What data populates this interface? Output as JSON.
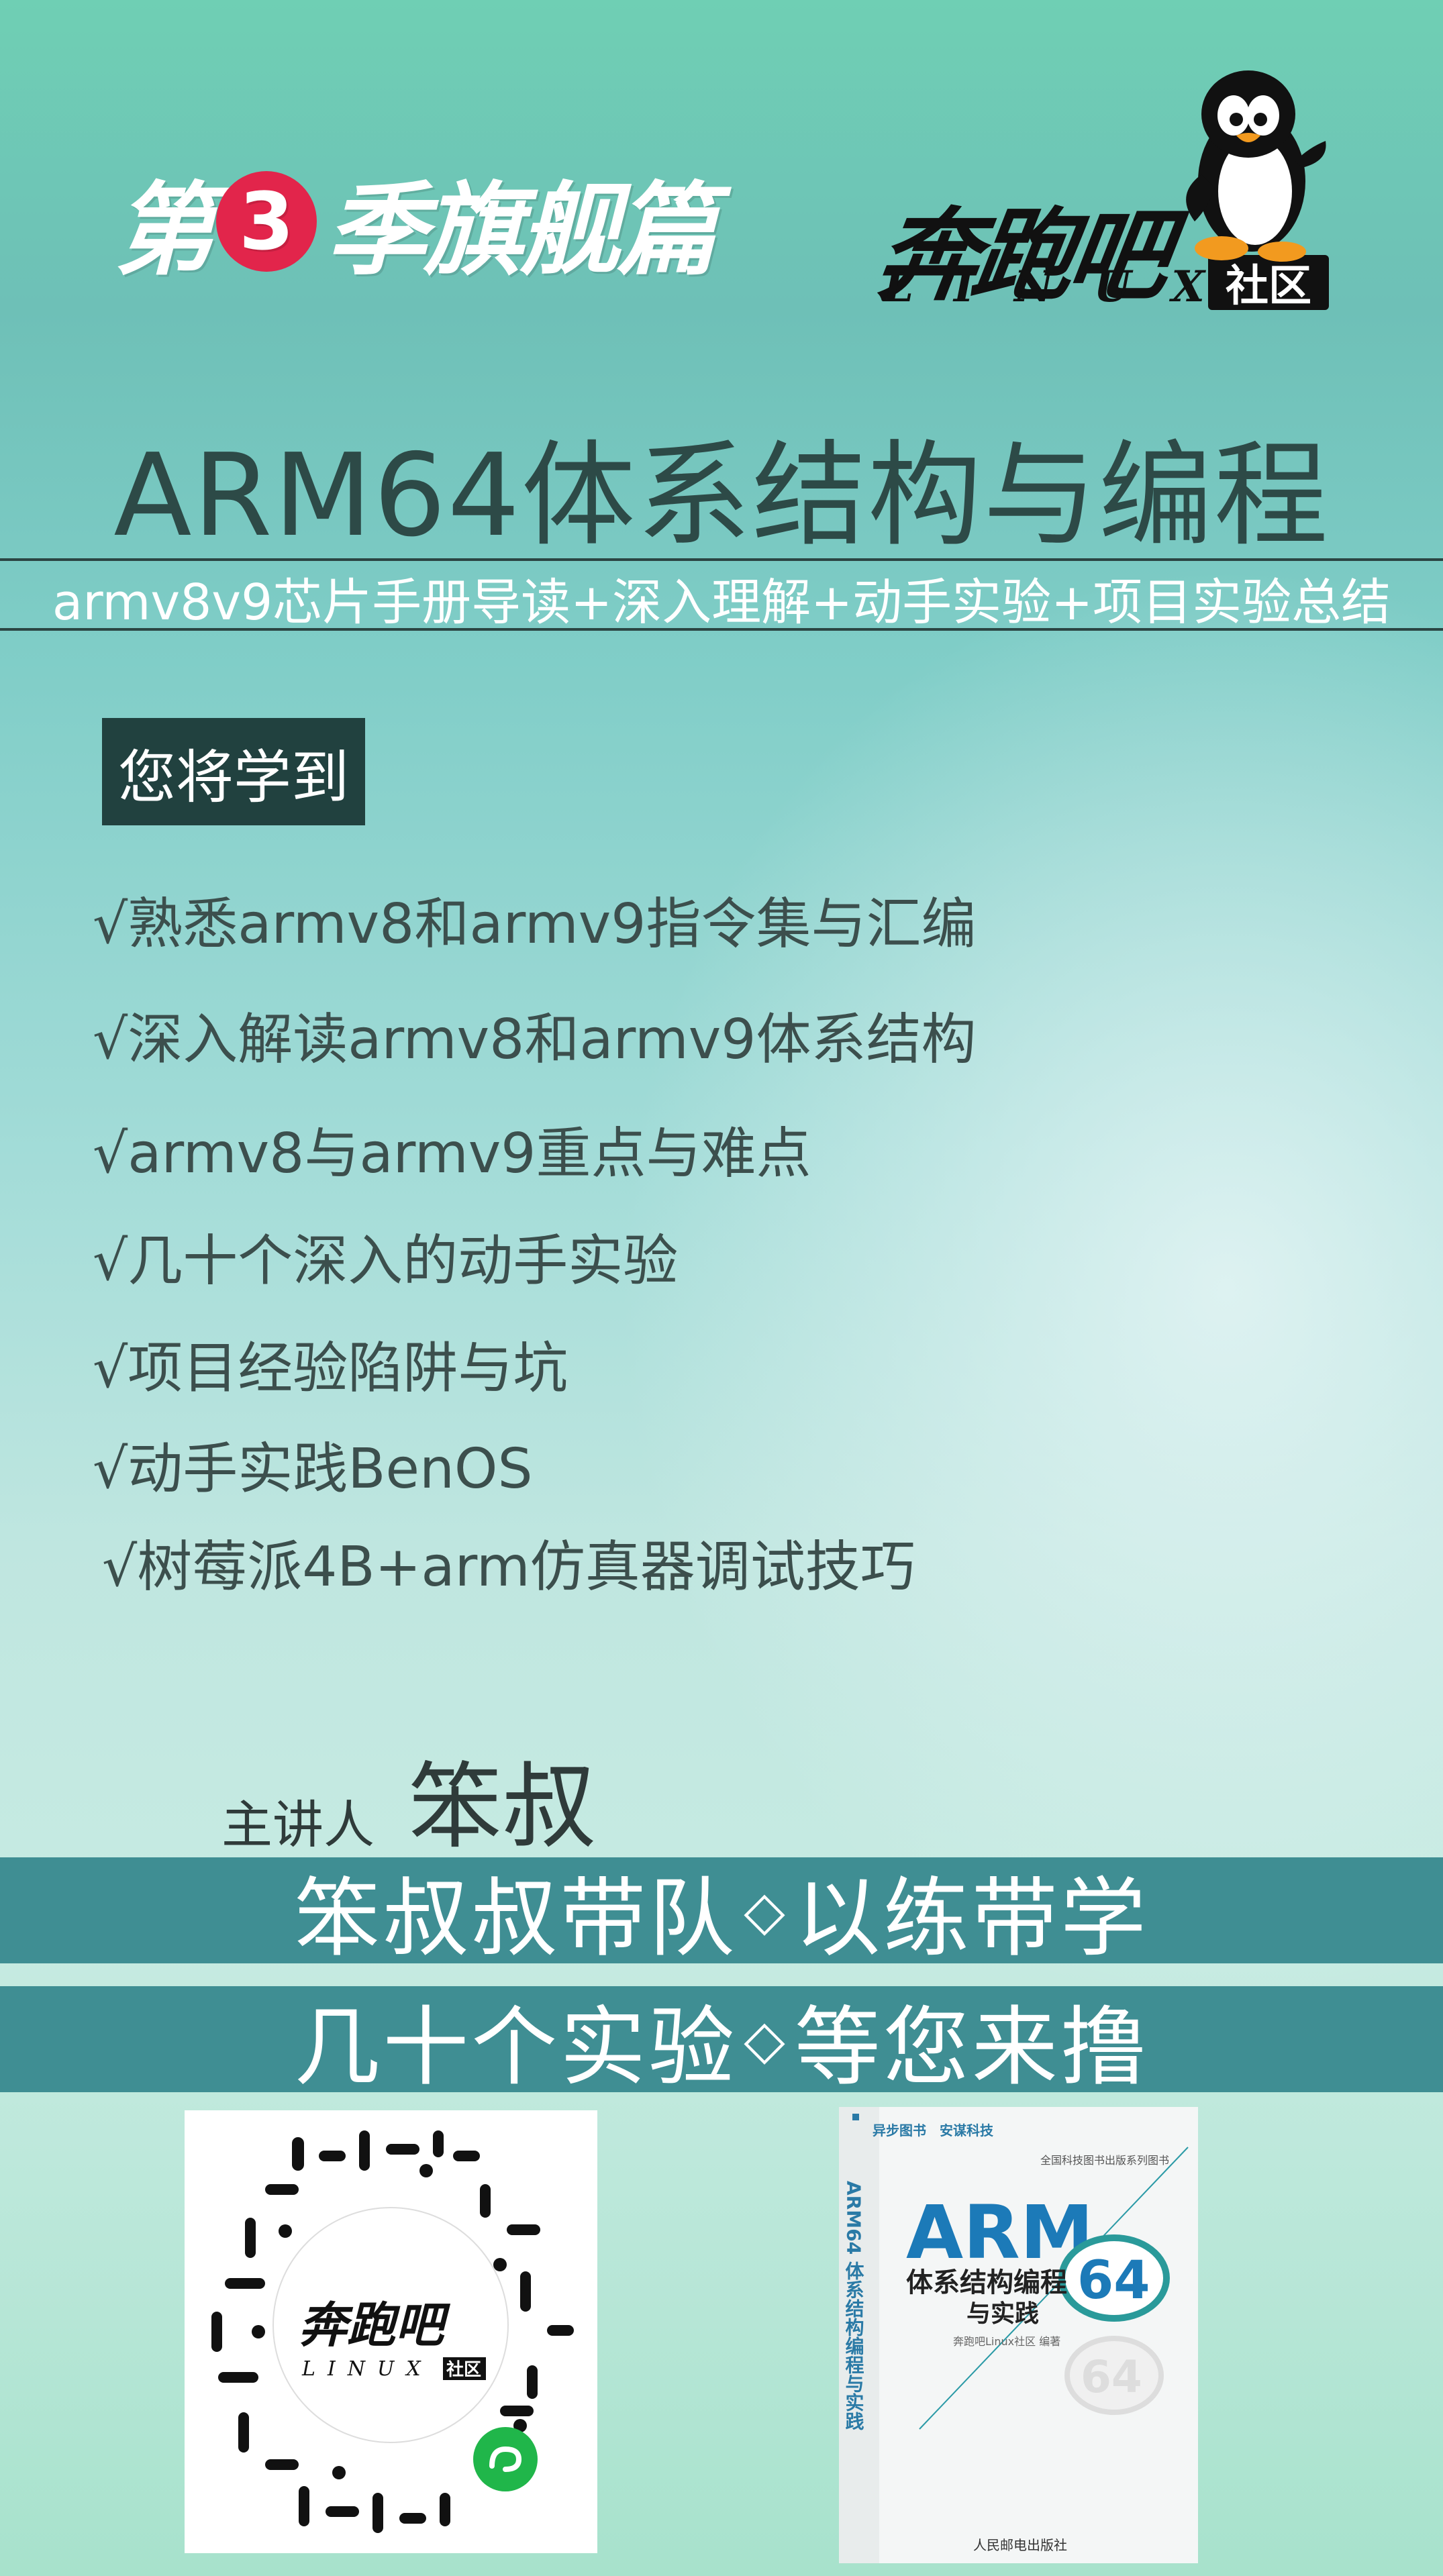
{
  "header": {
    "season_prefix": "第",
    "season_number": "3",
    "season_suffix": "季旗舰篇",
    "logo_name": "奔跑吧",
    "logo_linux": "LINUX",
    "logo_badge": "社区",
    "icons": [
      "penguin-mascot-icon"
    ]
  },
  "title": "ARM64体系结构与编程",
  "subtitle": "armv8v9芯片手册导读+深入理解+动手实验+项目实验总结",
  "learn": {
    "tag": "您将学到",
    "items": [
      "√熟悉armv8和armv9指令集与汇编",
      "√深入解读armv8和armv9体系结构",
      "√armv8与armv9重点与难点",
      "√几十个深入的动手实验",
      "√项目经验陷阱与坑",
      "√动手实践BenOS",
      "√树莓派4B+arm仿真器调试技巧"
    ]
  },
  "lecturer": {
    "label": "主讲人",
    "name": "笨叔"
  },
  "bands": {
    "band1_left": "笨叔叔带队",
    "band1_right": "以练带学",
    "band2_left": "几十个实验",
    "band2_right": "等您来撸",
    "separator": "◇"
  },
  "qr": {
    "center_logo": "奔跑吧",
    "center_linux": "LINUX",
    "center_badge": "社区",
    "icons": [
      "miniprogram-icon"
    ]
  },
  "book": {
    "publisher_top": "异步图书",
    "publisher_top2": "安谋科技",
    "series": "全国科技图书出版系列图书",
    "title_big": "ARM",
    "title_num": "64",
    "title_sub": "体系结构编程",
    "title_sub2": "与实践",
    "spine": "ARM64 体系结构编程与实践",
    "author": "奔跑吧Linux社区 编著",
    "footer": "人民邮电出版社"
  },
  "colors": {
    "accent_red": "#e2254b",
    "band": "#3f8e93",
    "tag_bg": "#21413f",
    "title_text": "#2d4a47"
  }
}
